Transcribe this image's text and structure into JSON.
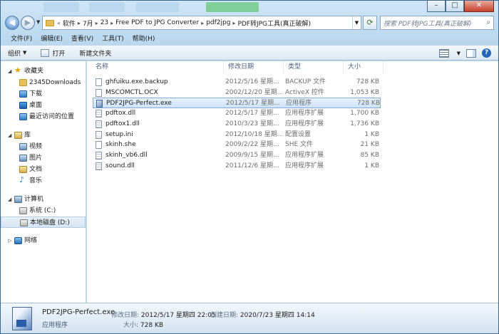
{
  "window": {
    "minimize": "–",
    "maximize": "□",
    "close": "✕"
  },
  "address": {
    "overflow": "«",
    "crumbs": [
      "软件",
      "7月",
      "23",
      "Free PDF to JPG Converter",
      "pdf2jpg",
      "PDF转JPG工具(真正破解)"
    ],
    "search_placeholder": "搜索 PDF转JPG工具(真正破解)"
  },
  "menu": [
    "文件(F)",
    "编辑(E)",
    "查看(V)",
    "工具(T)",
    "帮助(H)"
  ],
  "toolbar": {
    "organize": "组织",
    "open": "打开",
    "new_folder": "新建文件夹"
  },
  "nav": {
    "favorites": "收藏夹",
    "favorites_items": [
      "2345Downloads",
      "下载",
      "桌面",
      "最近访问的位置"
    ],
    "libraries": "库",
    "library_items": [
      "视频",
      "图片",
      "文档",
      "音乐"
    ],
    "computer": "计算机",
    "computer_items": [
      "系统 (C:)",
      "本地磁盘 (D:)"
    ],
    "network": "网络"
  },
  "columns": {
    "name": "名称",
    "date": "修改日期",
    "type": "类型",
    "size": "大小"
  },
  "files": [
    {
      "name": "ghfuiku.exe.backup",
      "date": "2012/5/16 星期...",
      "type": "BACKUP 文件",
      "size": "728 KB",
      "icon": "file"
    },
    {
      "name": "MSCOMCTL.OCX",
      "date": "2002/12/20 星期...",
      "type": "ActiveX 控件",
      "size": "1,053 KB",
      "icon": "file"
    },
    {
      "name": "PDF2JPG-Perfect.exe",
      "date": "2012/5/17 星期...",
      "type": "应用程序",
      "size": "728 KB",
      "icon": "exe",
      "selected": true
    },
    {
      "name": "pdftox.dll",
      "date": "2012/5/17 星期...",
      "type": "应用程序扩展",
      "size": "1,700 KB",
      "icon": "dll"
    },
    {
      "name": "pdftox1.dll",
      "date": "2010/3/23 星期...",
      "type": "应用程序扩展",
      "size": "1,736 KB",
      "icon": "dll"
    },
    {
      "name": "setup.ini",
      "date": "2012/10/18 星期...",
      "type": "配置设置",
      "size": "1 KB",
      "icon": "ini"
    },
    {
      "name": "skinh.she",
      "date": "2009/2/22 星期...",
      "type": "SHE 文件",
      "size": "21 KB",
      "icon": "file"
    },
    {
      "name": "skinh_vb6.dll",
      "date": "2009/9/15 星期...",
      "type": "应用程序扩展",
      "size": "85 KB",
      "icon": "dll"
    },
    {
      "name": "sound.dll",
      "date": "2011/12/6 星期...",
      "type": "应用程序扩展",
      "size": "1 KB",
      "icon": "dll"
    }
  ],
  "details": {
    "name": "PDF2JPG-Perfect.exe",
    "type": "应用程序",
    "modified_label": "修改日期:",
    "modified": "2012/5/17 星期四 22:05",
    "created_label": "创建日期:",
    "created": "2020/7/23 星期四 14:14",
    "size_label": "大小:",
    "size": "728 KB"
  }
}
